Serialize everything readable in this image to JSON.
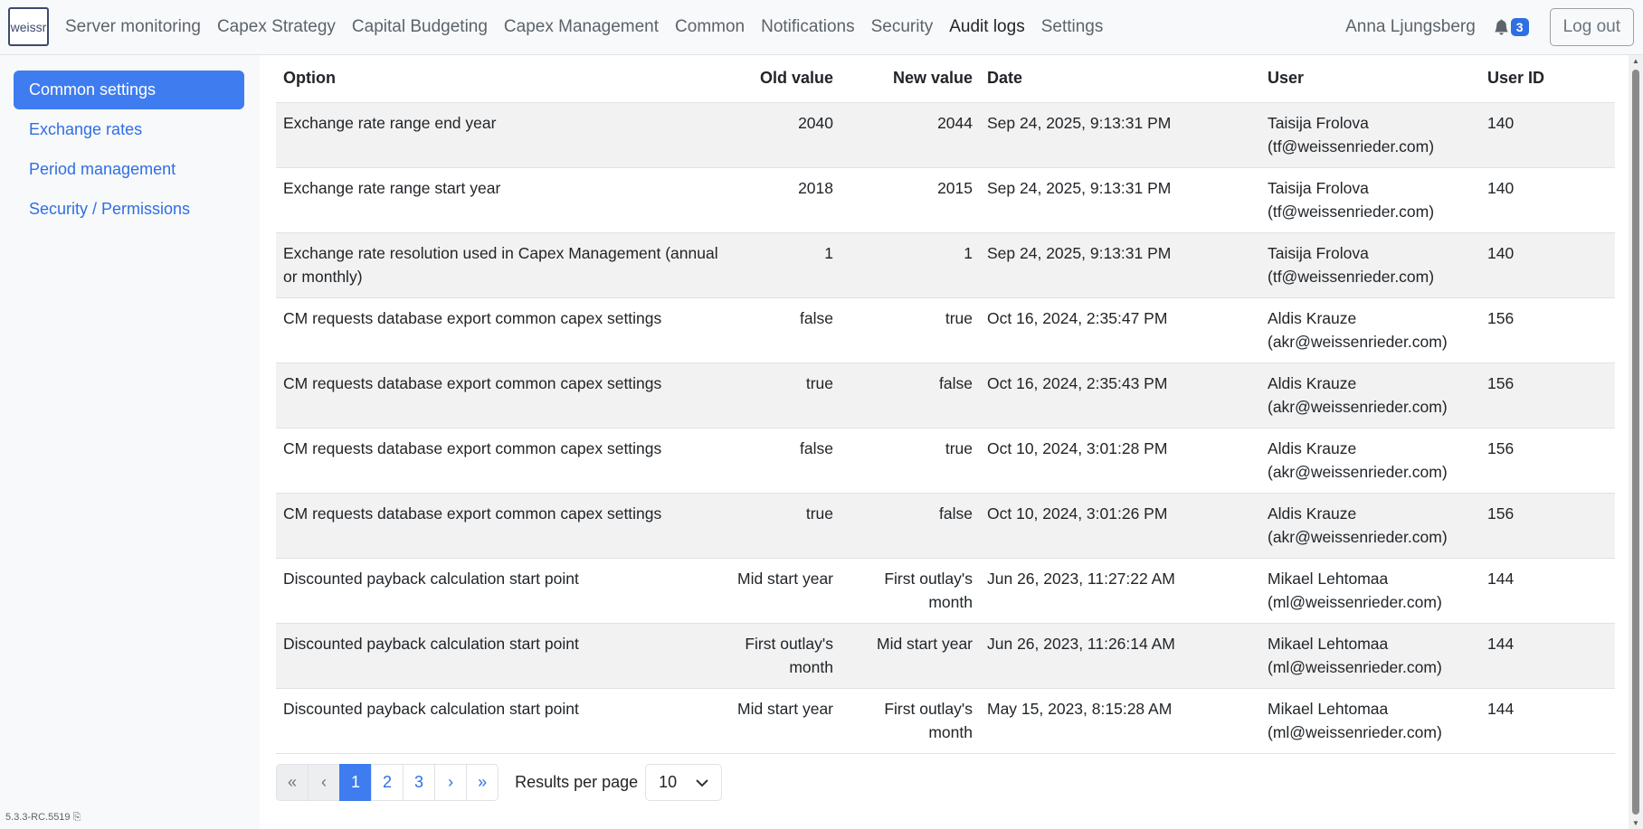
{
  "brand": {
    "logo_text": "weissr"
  },
  "nav": {
    "links": [
      {
        "label": "Server monitoring"
      },
      {
        "label": "Capex Strategy"
      },
      {
        "label": "Capital Budgeting"
      },
      {
        "label": "Capex Management"
      },
      {
        "label": "Common"
      },
      {
        "label": "Notifications"
      },
      {
        "label": "Security"
      },
      {
        "label": "Audit logs"
      },
      {
        "label": "Settings"
      }
    ],
    "active": "Audit logs",
    "user_name": "Anna Ljungsberg",
    "notification_count": "3",
    "logout_label": "Log out"
  },
  "sidebar": {
    "items": [
      {
        "label": "Common settings"
      },
      {
        "label": "Exchange rates"
      },
      {
        "label": "Period management"
      },
      {
        "label": "Security / Permissions"
      }
    ],
    "active_index": 0,
    "version": "5.3.3-RC.5519"
  },
  "table": {
    "columns": [
      "Option",
      "Old value",
      "New value",
      "Date",
      "User",
      "User ID"
    ],
    "rows": [
      {
        "option": "Exchange rate range end year",
        "old": "2040",
        "new": "2044",
        "date": "Sep 24, 2025, 9:13:31 PM",
        "user": "Taisija Frolova",
        "email": "(tf@weissenrieder.com)",
        "user_id": "140"
      },
      {
        "option": "Exchange rate range start year",
        "old": "2018",
        "new": "2015",
        "date": "Sep 24, 2025, 9:13:31 PM",
        "user": "Taisija Frolova",
        "email": "(tf@weissenrieder.com)",
        "user_id": "140"
      },
      {
        "option": "Exchange rate resolution used in Capex Management (annual or monthly)",
        "old": "1",
        "new": "1",
        "date": "Sep 24, 2025, 9:13:31 PM",
        "user": "Taisija Frolova",
        "email": "(tf@weissenrieder.com)",
        "user_id": "140"
      },
      {
        "option": "CM requests database export common capex settings",
        "old": "false",
        "new": "true",
        "date": "Oct 16, 2024, 2:35:47 PM",
        "user": "Aldis Krauze",
        "email": "(akr@weissenrieder.com)",
        "user_id": "156"
      },
      {
        "option": "CM requests database export common capex settings",
        "old": "true",
        "new": "false",
        "date": "Oct 16, 2024, 2:35:43 PM",
        "user": "Aldis Krauze",
        "email": "(akr@weissenrieder.com)",
        "user_id": "156"
      },
      {
        "option": "CM requests database export common capex settings",
        "old": "false",
        "new": "true",
        "date": "Oct 10, 2024, 3:01:28 PM",
        "user": "Aldis Krauze",
        "email": "(akr@weissenrieder.com)",
        "user_id": "156"
      },
      {
        "option": "CM requests database export common capex settings",
        "old": "true",
        "new": "false",
        "date": "Oct 10, 2024, 3:01:26 PM",
        "user": "Aldis Krauze",
        "email": "(akr@weissenrieder.com)",
        "user_id": "156"
      },
      {
        "option": "Discounted payback calculation start point",
        "old": "Mid start year",
        "new": "First outlay's month",
        "date": "Jun 26, 2023, 11:27:22 AM",
        "user": "Mikael Lehtomaa",
        "email": "(ml@weissenrieder.com)",
        "user_id": "144"
      },
      {
        "option": "Discounted payback calculation start point",
        "old": "First outlay's month",
        "new": "Mid start year",
        "date": "Jun 26, 2023, 11:26:14 AM",
        "user": "Mikael Lehtomaa",
        "email": "(ml@weissenrieder.com)",
        "user_id": "144"
      },
      {
        "option": "Discounted payback calculation start point",
        "old": "Mid start year",
        "new": "First outlay's month",
        "date": "May 15, 2023, 8:15:28 AM",
        "user": "Mikael Lehtomaa",
        "email": "(ml@weissenrieder.com)",
        "user_id": "144"
      }
    ]
  },
  "pagination": {
    "first": "«",
    "prev": "‹",
    "pages": [
      "1",
      "2",
      "3"
    ],
    "current": "1",
    "next": "›",
    "last": "»",
    "results_per_page_label": "Results per page",
    "results_per_page_value": "10"
  },
  "colors": {
    "accent": "#3e7cf0",
    "link": "#2f6fe4",
    "stripe": "#f2f2f2"
  },
  "icons": {
    "notifications": "bell-icon",
    "select": "chevron-down-icon"
  }
}
